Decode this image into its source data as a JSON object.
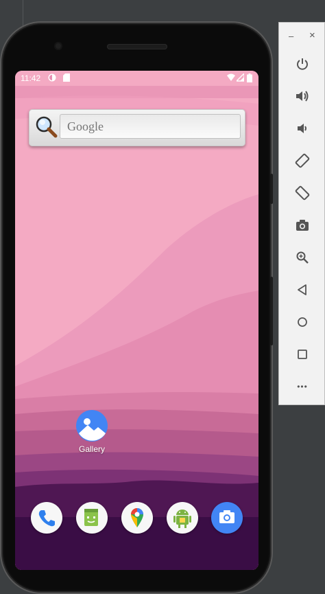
{
  "status_bar": {
    "time": "11:42"
  },
  "search_widget": {
    "placeholder": "Google"
  },
  "desktop_apps": [
    {
      "label": "Gallery"
    }
  ],
  "dock": [
    {
      "icon": "phone-icon"
    },
    {
      "icon": "messages-icon"
    },
    {
      "icon": "maps-icon"
    },
    {
      "icon": "android-app-icon"
    },
    {
      "icon": "camera-icon"
    }
  ],
  "nav_bar": {
    "buttons": [
      "back-icon",
      "home-icon",
      "recents-icon"
    ]
  },
  "emulator_toolbar": {
    "window_controls": {
      "minimize": "–",
      "close": "×"
    },
    "more_label": "•••",
    "buttons": [
      "power-icon",
      "volume-up-icon",
      "volume-down-icon",
      "rotate-left-icon",
      "rotate-right-icon",
      "screenshot-icon",
      "zoom-icon",
      "back-icon",
      "home-icon",
      "overview-icon"
    ]
  },
  "colors": {
    "wallpaper_top": "#f4aac3",
    "wallpaper_bottom": "#3a0d45",
    "toolbar_bg": "#f2f2f2",
    "accent_blue": "#4285f4"
  }
}
